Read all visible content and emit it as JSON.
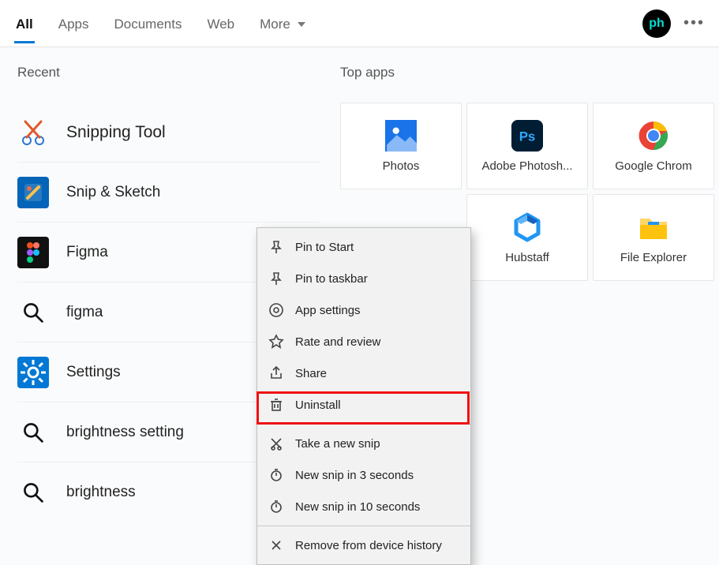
{
  "header": {
    "tabs": [
      "All",
      "Apps",
      "Documents",
      "Web",
      "More"
    ],
    "active_tab_index": 0,
    "avatar_text": "ph"
  },
  "left": {
    "section_title": "Recent",
    "items": [
      {
        "label": "Snipping Tool",
        "icon": "snipping-tool"
      },
      {
        "label": "Snip & Sketch",
        "icon": "snip-sketch"
      },
      {
        "label": "Figma",
        "icon": "figma"
      },
      {
        "label": "figma",
        "icon": "search"
      },
      {
        "label": "Settings",
        "icon": "settings"
      },
      {
        "label": "brightness setting",
        "icon": "search"
      },
      {
        "label": "brightness",
        "icon": "search"
      }
    ]
  },
  "right": {
    "section_title": "Top apps",
    "tiles": [
      {
        "label": "Photos",
        "icon": "photos"
      },
      {
        "label": "Adobe Photosh...",
        "icon": "photoshop"
      },
      {
        "label": "Google Chrom",
        "icon": "chrome"
      },
      {
        "label": "Hubstaff",
        "icon": "hubstaff"
      },
      {
        "label": "File Explorer",
        "icon": "file-explorer"
      }
    ]
  },
  "context_menu": {
    "items": [
      {
        "label": "Pin to Start",
        "icon": "pin"
      },
      {
        "label": "Pin to taskbar",
        "icon": "pin"
      },
      {
        "label": "App settings",
        "icon": "gear"
      },
      {
        "label": "Rate and review",
        "icon": "star"
      },
      {
        "label": "Share",
        "icon": "share"
      },
      {
        "label": "Uninstall",
        "icon": "trash",
        "highlighted": true
      },
      {
        "sep": true
      },
      {
        "label": "Take a new snip",
        "icon": "snip-new"
      },
      {
        "label": "New snip in 3 seconds",
        "icon": "snip-timer"
      },
      {
        "label": "New snip in 10 seconds",
        "icon": "snip-timer"
      },
      {
        "sep": true
      },
      {
        "label": "Remove from device history",
        "icon": "x"
      }
    ]
  }
}
